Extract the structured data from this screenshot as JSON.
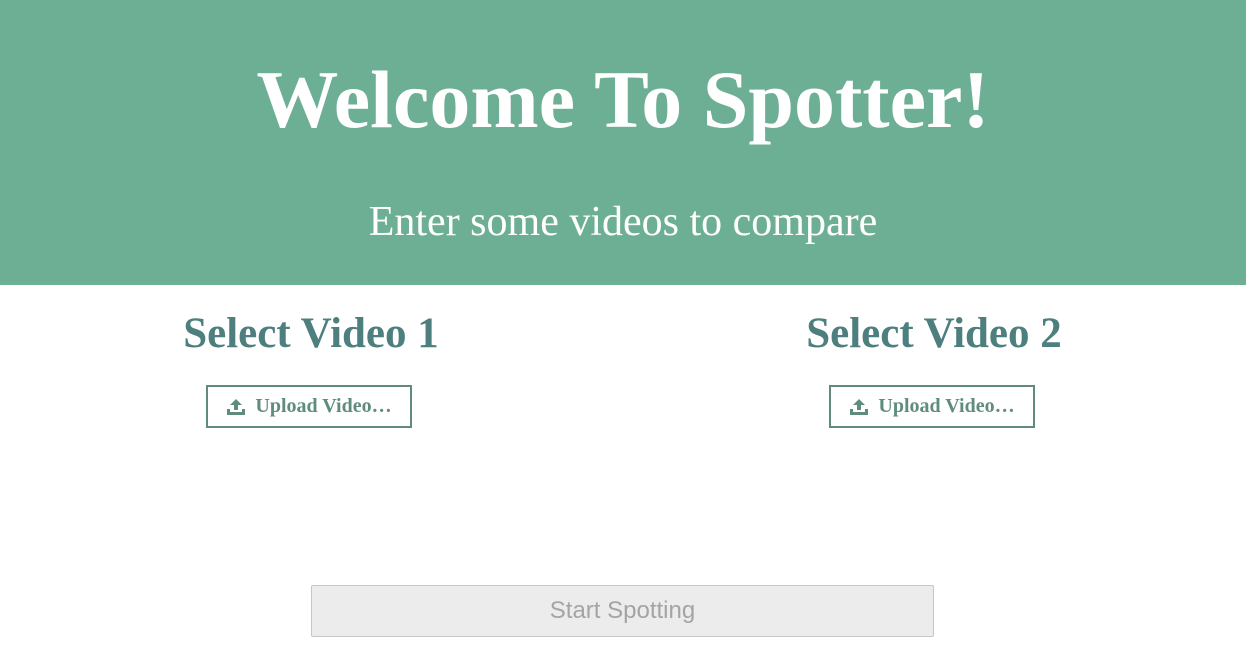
{
  "hero": {
    "title": "Welcome To Spotter!",
    "subtitle": "Enter some videos to compare",
    "background_color": "#6caf94"
  },
  "video_selectors": [
    {
      "heading": "Select Video 1",
      "button_label": "Upload Video…",
      "icon": "upload-icon"
    },
    {
      "heading": "Select Video 2",
      "button_label": "Upload Video…",
      "icon": "upload-icon"
    }
  ],
  "start_button": {
    "label": "Start Spotting",
    "state": "disabled"
  },
  "colors": {
    "accent": "#5f8c7e",
    "heading": "#4e7f7f",
    "disabled_bg": "#ececec",
    "disabled_text": "#a4a4a4"
  }
}
